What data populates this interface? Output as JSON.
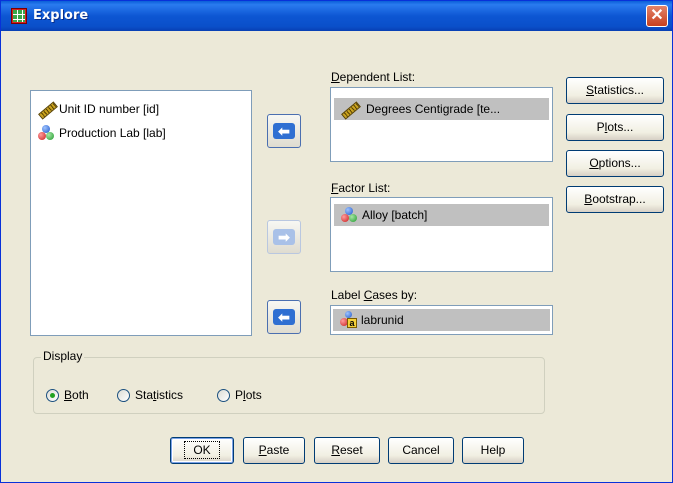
{
  "window": {
    "title": "Explore",
    "close_glyph": "✕"
  },
  "source_list": {
    "items": [
      {
        "label": "Unit ID number [id]",
        "icon": "ruler-icon"
      },
      {
        "label": "Production Lab [lab]",
        "icon": "nominal-balls-icon"
      }
    ]
  },
  "dependent_list": {
    "label_pre": "",
    "label_access": "D",
    "label_post": "ependent List:",
    "items": [
      {
        "label": "Degrees Centigrade [te...",
        "icon": "ruler-icon",
        "selected": true
      }
    ]
  },
  "factor_list": {
    "label_pre": "",
    "label_access": "F",
    "label_post": "actor List:",
    "items": [
      {
        "label": "Alloy [batch]",
        "icon": "nominal-balls-icon",
        "selected": true
      }
    ]
  },
  "label_cases": {
    "label_pre": "Label ",
    "label_access": "C",
    "label_post": "ases by:",
    "value": "labrunid",
    "icon": "label-case-icon"
  },
  "side_buttons": {
    "statistics_pre": "",
    "statistics_access": "S",
    "statistics_post": "tatistics...",
    "plots_pre": "P",
    "plots_access": "l",
    "plots_post": "ots...",
    "options_pre": "",
    "options_access": "O",
    "options_post": "ptions...",
    "bootstrap_pre": "",
    "bootstrap_access": "B",
    "bootstrap_post": "ootstrap..."
  },
  "display": {
    "title": "Display",
    "options": [
      {
        "pre": "",
        "access": "B",
        "post": "oth",
        "checked": true
      },
      {
        "pre": "Sta",
        "access": "t",
        "post": "istics",
        "checked": false
      },
      {
        "pre": "P",
        "access": "l",
        "post": "ots",
        "checked": false
      }
    ]
  },
  "bottom_buttons": {
    "ok": "OK",
    "paste_pre": "",
    "paste_access": "P",
    "paste_post": "aste",
    "reset_pre": "",
    "reset_access": "R",
    "reset_post": "eset",
    "cancel": "Cancel",
    "help": "Help"
  },
  "colors": {
    "dialog_bg": "#ECE9D8",
    "title_bar": "#0A4FC9",
    "selection": "#C0C0C0",
    "arrow_blue": "#2F6FD2"
  }
}
